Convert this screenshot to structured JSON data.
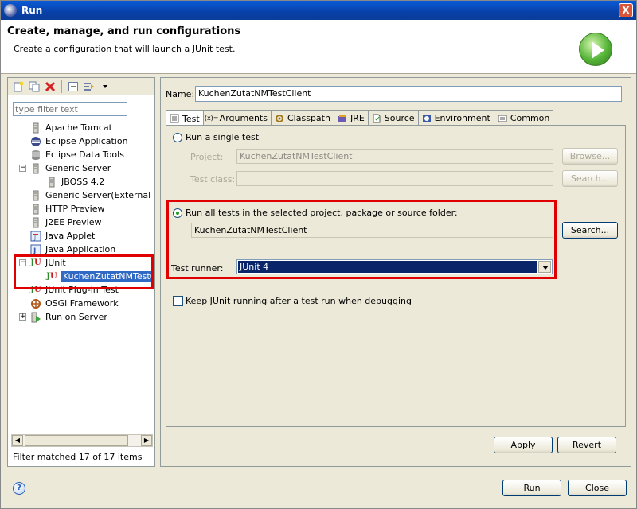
{
  "window": {
    "title": "Run",
    "close_label": "X"
  },
  "header": {
    "title": "Create, manage, and run configurations",
    "subtitle": "Create a configuration that will launch a JUnit test."
  },
  "sidebar": {
    "filter_placeholder": "type filter text",
    "items": [
      {
        "label": "Apache Tomcat",
        "icon": "tomcat-icon"
      },
      {
        "label": "Eclipse Application",
        "icon": "eclipse-icon"
      },
      {
        "label": "Eclipse Data Tools",
        "icon": "database-icon"
      },
      {
        "label": "Generic Server",
        "icon": "server-icon"
      },
      {
        "label": "JBOSS 4.2",
        "icon": "server-config-icon"
      },
      {
        "label": "Generic Server(External La",
        "icon": "server-icon"
      },
      {
        "label": "HTTP Preview",
        "icon": "server-icon"
      },
      {
        "label": "J2EE Preview",
        "icon": "server-icon"
      },
      {
        "label": "Java Applet",
        "icon": "applet-icon"
      },
      {
        "label": "Java Application",
        "icon": "java-app-icon"
      },
      {
        "label": "JUnit",
        "icon": "junit-icon"
      },
      {
        "label": "KuchenZutatNMTestClient",
        "icon": "junit-icon"
      },
      {
        "label": "JUnit Plug-in Test",
        "icon": "junit-icon"
      },
      {
        "label": "OSGi Framework",
        "icon": "osgi-icon"
      },
      {
        "label": "Run on Server",
        "icon": "run-server-icon"
      }
    ],
    "filter_status": "Filter matched 17 of 17 items"
  },
  "config": {
    "name_label": "Name:",
    "name_value": "KuchenZutatNMTestClient",
    "tabs": [
      "Test",
      "Arguments",
      "Classpath",
      "JRE",
      "Source",
      "Environment",
      "Common"
    ],
    "single_test_label": "Run a single test",
    "project_label": "Project:",
    "project_value": "KuchenZutatNMTestClient",
    "browse_label": "Browse...",
    "test_class_label": "Test class:",
    "search_disabled_label": "Search...",
    "all_tests_label": "Run all tests in the selected project, package or source folder:",
    "container_value": "KuchenZutatNMTestClient",
    "search_label": "Search...",
    "runner_label": "Test runner:",
    "runner_value": "JUnit 4",
    "keep_running_label": "Keep JUnit running after a test run when debugging",
    "apply_label": "Apply",
    "revert_label": "Revert"
  },
  "footer": {
    "run_label": "Run",
    "close_label": "Close",
    "help_label": "?"
  },
  "colors": {
    "highlight": "#e00000",
    "selection": "#316ac5",
    "title_bar": "#0840a8"
  }
}
